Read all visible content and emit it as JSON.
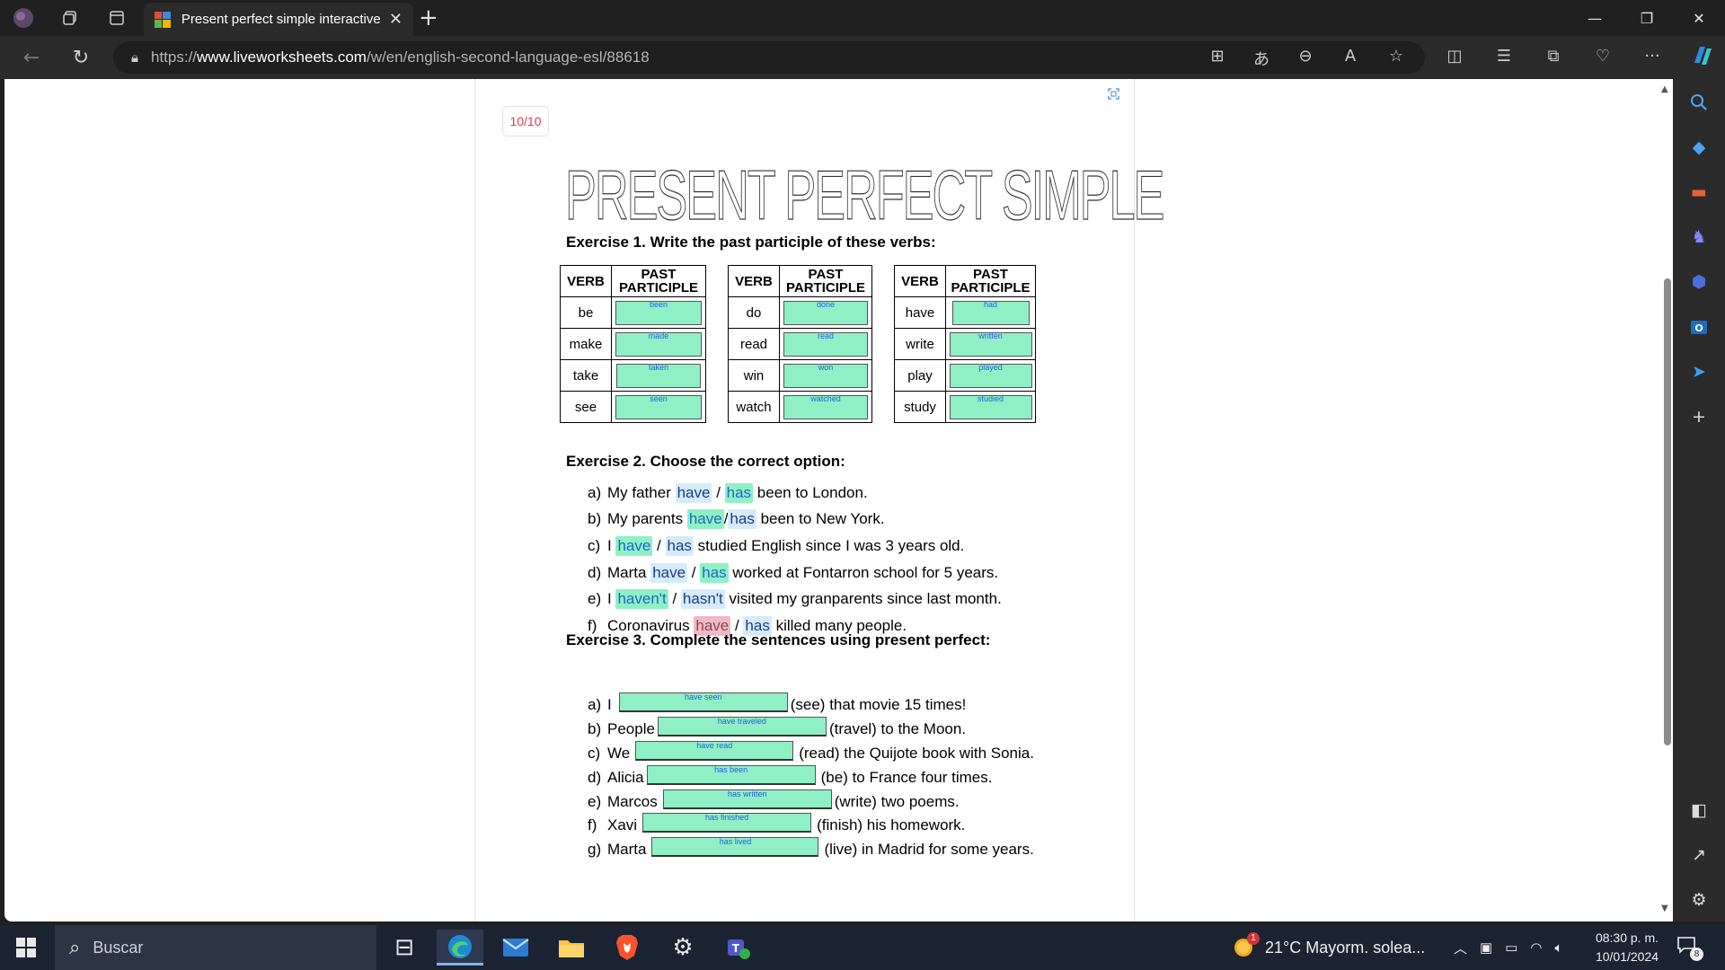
{
  "browser": {
    "tab_title": "Present perfect simple interactive",
    "url_prefix": "https://",
    "url_domain": "www.liveworksheets.com",
    "url_path": "/w/en/english-second-language-esl/88618"
  },
  "worksheet": {
    "score": "10/10",
    "title": "PRESENT PERFECT SIMPLE",
    "ex1_heading": "Exercise 1. Write the past participle of these verbs:",
    "col_verb": "VERB",
    "col_pp": "PAST PARTICIPLE",
    "tables": [
      {
        "rows": [
          {
            "verb": "be",
            "answer": "been"
          },
          {
            "verb": "make",
            "answer": "made"
          },
          {
            "verb": "take",
            "answer": "taken"
          },
          {
            "verb": "see",
            "answer": "seen"
          }
        ]
      },
      {
        "rows": [
          {
            "verb": "do",
            "answer": "done"
          },
          {
            "verb": "read",
            "answer": "read"
          },
          {
            "verb": "win",
            "answer": "won"
          },
          {
            "verb": "watch",
            "answer": "watched"
          }
        ]
      },
      {
        "rows": [
          {
            "verb": "have",
            "answer": "had"
          },
          {
            "verb": "write",
            "answer": "written"
          },
          {
            "verb": "play",
            "answer": "played"
          },
          {
            "verb": "study",
            "answer": "studied"
          }
        ]
      }
    ],
    "ex2_heading": "Exercise 2. Choose the correct option:",
    "ex2_items": [
      {
        "letter": "a)",
        "pre": "My father ",
        "opt1": "have",
        "opt2": "has",
        "post": " been to London."
      },
      {
        "letter": "b)",
        "pre": "My parents ",
        "opt1": "have",
        "opt2": "has",
        "post": " been to New York."
      },
      {
        "letter": "c)",
        "pre": "I ",
        "opt1": "have",
        "opt2": "has",
        "post": " studied English since I was 3 years old."
      },
      {
        "letter": "d)",
        "pre": "Marta ",
        "opt1": "have",
        "opt2": "has",
        "post": " worked at Fontarron school for 5 years."
      },
      {
        "letter": "e)",
        "pre": "I ",
        "opt1": "haven't",
        "opt2": "hasn't",
        "post": " visited my granparents since last month."
      },
      {
        "letter": "f)",
        "pre": "Coronavirus ",
        "opt1": "have",
        "opt2": "has",
        "post": " killed many people."
      }
    ],
    "ex3_heading": "Exercise 3. Complete the sentences using present perfect:",
    "ex3_items": [
      {
        "letter": "a)",
        "pre": "I",
        "answer": "have seen",
        "post": "(see) that movie 15 times!"
      },
      {
        "letter": "b)",
        "pre": "People",
        "answer": "have traveled",
        "post": "(travel) to the Moon."
      },
      {
        "letter": "c)",
        "pre": "We",
        "answer": "have read",
        "post": "(read) the Quijote book with Sonia."
      },
      {
        "letter": "d)",
        "pre": "Alicia",
        "answer": "has been",
        "post": "(be) to France four times."
      },
      {
        "letter": "e)",
        "pre": "Marcos",
        "answer": "has written",
        "post": "(write) two poems."
      },
      {
        "letter": "f)",
        "pre": "Xavi",
        "answer": "has finished",
        "post": "(finish) his homework."
      },
      {
        "letter": "g)",
        "pre": "Marta",
        "answer": "has lived",
        "post": "(live) in Madrid for some years."
      }
    ]
  },
  "taskbar": {
    "search_placeholder": "Buscar",
    "weather": "21°C  Mayorm. solea...",
    "time": "08:30 p. m.",
    "date": "10/01/2024",
    "notification_count": "8",
    "weather_badge": "1"
  },
  "colors": {
    "correct": "#8ff0c6",
    "unselected": "#d6ebfa",
    "wrong": "#f0b8c4",
    "score": "#e0384b"
  }
}
